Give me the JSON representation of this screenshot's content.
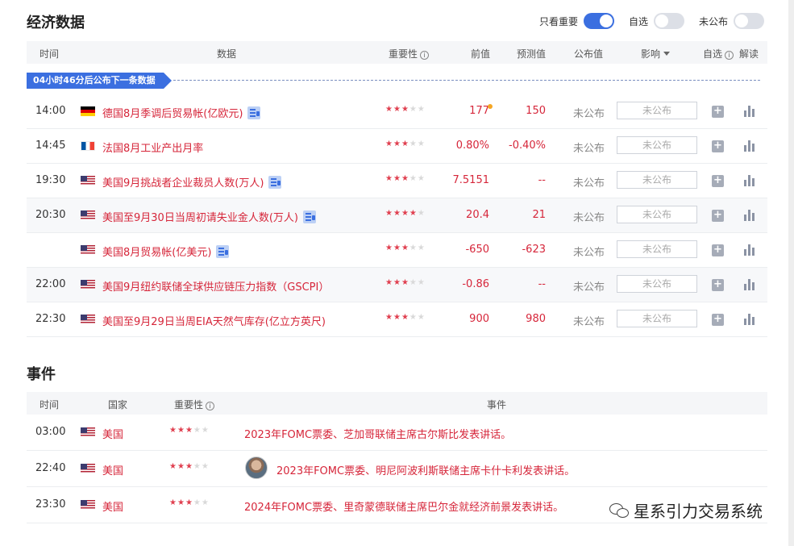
{
  "econ": {
    "title": "经济数据",
    "toggles": [
      {
        "label": "只看重要",
        "on": true
      },
      {
        "label": "自选",
        "on": false
      },
      {
        "label": "未公布",
        "on": false
      }
    ],
    "columns": {
      "time": "时间",
      "data": "数据",
      "importance": "重要性",
      "previous": "前值",
      "forecast": "预测值",
      "actual": "公布值",
      "impact": "影响",
      "watch": "自选",
      "interpret": "解读"
    },
    "next_notice": "04小时46分后公布下一条数据",
    "rows": [
      {
        "time": "14:00",
        "flag": "de",
        "name": "德国8月季调后贸易帐(亿欧元)",
        "doc": true,
        "stars": 3,
        "previous": "177",
        "forecast": "150",
        "actual": "未公布",
        "impact": "未公布"
      },
      {
        "time": "14:45",
        "flag": "fr",
        "name": "法国8月工业产出月率",
        "doc": false,
        "stars": 3,
        "previous": "0.80%",
        "forecast": "-0.40%",
        "actual": "未公布",
        "impact": "未公布"
      },
      {
        "time": "19:30",
        "flag": "us",
        "name": "美国9月挑战者企业裁员人数(万人)",
        "doc": true,
        "stars": 3,
        "previous": "7.5151",
        "forecast": "--",
        "actual": "未公布",
        "impact": "未公布"
      },
      {
        "time": "20:30",
        "flag": "us",
        "name": "美国至9月30日当周初请失业金人数(万人)",
        "doc": true,
        "stars": 4,
        "previous": "20.4",
        "forecast": "21",
        "actual": "未公布",
        "impact": "未公布"
      },
      {
        "time": "",
        "flag": "us",
        "name": "美国8月贸易帐(亿美元)",
        "doc": true,
        "stars": 3,
        "previous": "-650",
        "forecast": "-623",
        "actual": "未公布",
        "impact": "未公布"
      },
      {
        "time": "22:00",
        "flag": "us",
        "name": "美国9月纽约联储全球供应链压力指数（GSCPI）",
        "doc": false,
        "stars": 3,
        "previous": "-0.86",
        "forecast": "--",
        "actual": "未公布",
        "impact": "未公布"
      },
      {
        "time": "22:30",
        "flag": "us",
        "name": "美国至9月29日当周EIA天然气库存(亿立方英尺)",
        "doc": false,
        "stars": 3,
        "previous": "900",
        "forecast": "980",
        "actual": "未公布",
        "impact": "未公布"
      }
    ]
  },
  "events": {
    "title": "事件",
    "columns": {
      "time": "时间",
      "country": "国家",
      "importance": "重要性",
      "event": "事件"
    },
    "rows": [
      {
        "time": "03:00",
        "flag": "us",
        "country": "美国",
        "stars": 3,
        "event": "2023年FOMC票委、芝加哥联储主席古尔斯比发表讲话。",
        "avatar": false
      },
      {
        "time": "22:40",
        "flag": "us",
        "country": "美国",
        "stars": 3,
        "event": "2023年FOMC票委、明尼阿波利斯联储主席卡什卡利发表讲话。",
        "avatar": true
      },
      {
        "time": "23:30",
        "flag": "us",
        "country": "美国",
        "stars": 3,
        "event": "2024年FOMC票委、里奇蒙德联储主席巴尔金就经济前景发表讲话。",
        "avatar": false
      }
    ]
  },
  "watermark": "星系引力交易系统",
  "colors": {
    "accent": "#3b6fe0",
    "red": "#d6263a",
    "star_on": "#e04050"
  }
}
